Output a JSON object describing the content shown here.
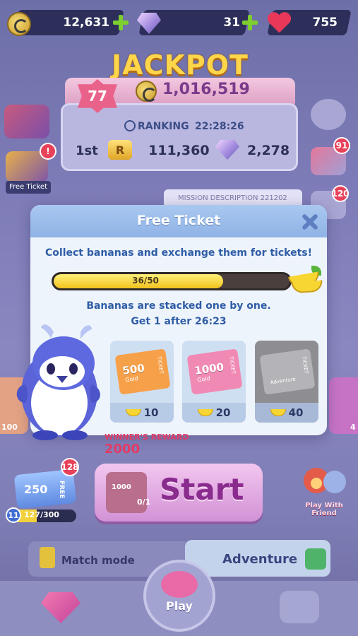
{
  "currency": {
    "coins": "12,631",
    "gems": "31",
    "hearts": "755"
  },
  "jackpot": {
    "title": "JACKPOT",
    "level": "77",
    "amount": "1,016,519",
    "ranking_label": "RANKING",
    "time_left": "22:28:26",
    "rank": "1st",
    "rank_icon": "R",
    "score": "111,360",
    "gems": "2,278"
  },
  "side": {
    "free_ticket_label": "Free Ticket",
    "free_ticket_badge": "!",
    "right_badge_1": "91",
    "right_badge_2": "120",
    "mission_text": "MISSION DESCRIPTION  221202"
  },
  "modal": {
    "title": "Free Ticket",
    "description": "Collect bananas and exchange them for tickets!",
    "progress_text": "36/50",
    "progress_fraction": 0.72,
    "stack_text": "Bananas are stacked one by one.",
    "timer_text": "Get 1 after 26:23",
    "tickets": [
      {
        "amount": "500",
        "sub": "Gold",
        "tag": "TICKET",
        "cost": "10",
        "color": "#f6a04a"
      },
      {
        "amount": "1000",
        "sub": "Gold",
        "tag": "TICKET",
        "cost": "20",
        "color": "#f08ab4"
      },
      {
        "amount": "",
        "sub": "Adventure",
        "tag": "TICKET",
        "cost": "40",
        "color": "#b4b4b8"
      }
    ]
  },
  "reward": {
    "label": "WINNER'S REWARD",
    "value": "2000"
  },
  "left_side": {
    "side_value": "100"
  },
  "right_side": {
    "side_value": "4"
  },
  "start": {
    "label": "Start",
    "ticket_amount": "1000",
    "ticket_count": "0/1"
  },
  "ticket_panel": {
    "badge": "128",
    "ticket_value": "250",
    "ticket_tag": "FREE",
    "level": "11",
    "progress_text": "127/300",
    "progress_fraction": 0.42
  },
  "friend": {
    "label": "Play With Friend"
  },
  "modes": {
    "match_label": "Match mode",
    "adventure_label": "Adventure"
  },
  "nav": {
    "play_label": "Play"
  }
}
